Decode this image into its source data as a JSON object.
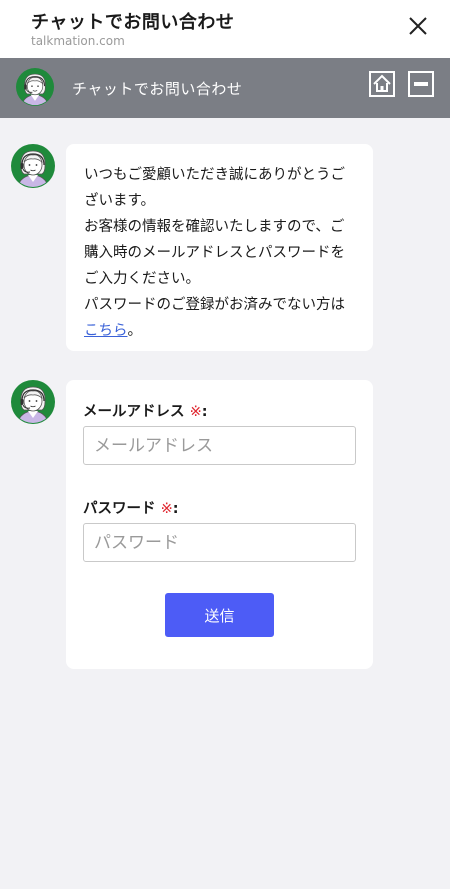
{
  "topbar": {
    "title": "チャットでお問い合わせ",
    "domain": "talkmation.com"
  },
  "header": {
    "title": "チャットでお問い合わせ"
  },
  "message1": {
    "text": "いつもご愛顧いただき誠にありがとうございます。\nお客様の情報を確認いたしますので、ご購入時のメールアドレスとパスワードをご入力ください。\nパスワードのご登録がお済みでない方は",
    "link_text": "こちら",
    "suffix": "。"
  },
  "form": {
    "email_label": "メールアドレス",
    "email_placeholder": "メールアドレス",
    "password_label": "パスワード",
    "password_placeholder": "パスワード",
    "required_mark": "※",
    "colon": ":",
    "submit_label": "送信"
  },
  "colors": {
    "header_bg": "#7b7e85",
    "accent": "#4d5cf6",
    "required": "#e0262f",
    "link": "#3b62d8",
    "avatar_bg": "#1f8a3b"
  }
}
